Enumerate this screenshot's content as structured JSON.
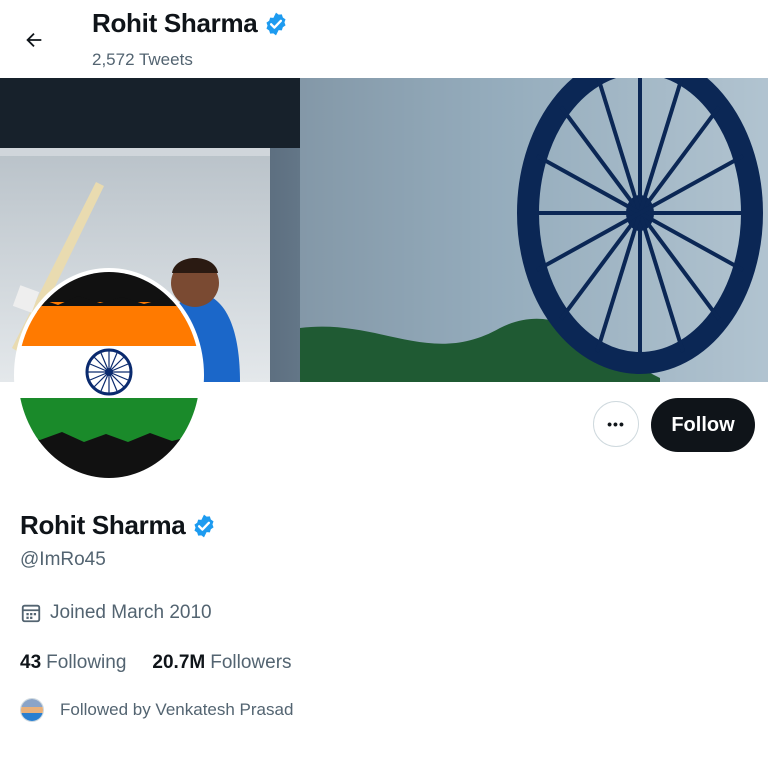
{
  "header": {
    "name": "Rohit Sharma",
    "tweet_count": "2,572 Tweets",
    "back_icon": "arrow-left-icon",
    "verified_icon": "verified-badge-icon"
  },
  "profile": {
    "name": "Rohit Sharma",
    "handle": "@ImRo45",
    "joined": "Joined March 2010",
    "joined_icon": "calendar-icon",
    "following_count": "43",
    "following_label": "Following",
    "followers_count": "20.7M",
    "followers_label": "Followers",
    "followed_by": "Followed by Venkatesh Prasad"
  },
  "actions": {
    "more_label": "•••",
    "follow_label": "Follow"
  },
  "colors": {
    "verified": "#1d9bf0",
    "follow_button": "#0f1419",
    "secondary_text": "#536471",
    "saffron": "#ff7a00",
    "green": "#1a8a2a",
    "chakra_blue": "#0a2a6e"
  }
}
